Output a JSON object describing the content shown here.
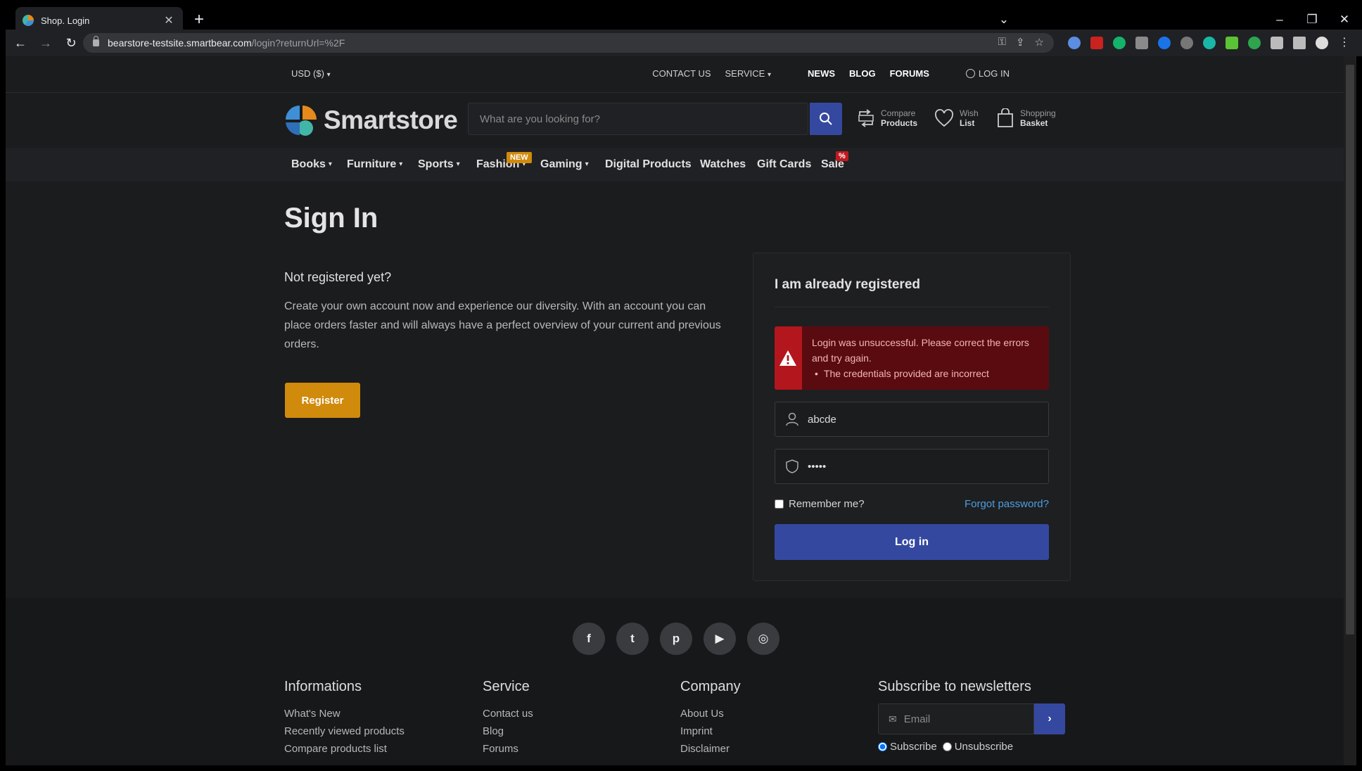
{
  "browser": {
    "tab_title": "Shop. Login",
    "new_tab": "+",
    "url_host": "bearstore-testsite.smartbear.com",
    "url_path": "/login?returnUrl=%2F"
  },
  "topbar": {
    "currency": "USD  ($)",
    "contact": "CONTACT US",
    "service": "SERVICE",
    "news": "NEWS",
    "blog": "BLOG",
    "forums": "FORUMS",
    "login": "LOG IN"
  },
  "header": {
    "logo_text": "Smartstore",
    "search_placeholder": "What are you looking for?",
    "compare_l1": "Compare",
    "compare_l2": "Products",
    "wish_l1": "Wish",
    "wish_l2": "List",
    "basket_l1": "Shopping",
    "basket_l2": "Basket"
  },
  "categories": {
    "books": "Books",
    "furniture": "Furniture",
    "sports": "Sports",
    "fashion": "Fashion",
    "fashion_badge": "NEW",
    "gaming": "Gaming",
    "digital": "Digital Products",
    "watches": "Watches",
    "giftcards": "Gift Cards",
    "sale": "Sale",
    "sale_badge": "%"
  },
  "main": {
    "title": "Sign In",
    "register_heading": "Not registered yet?",
    "register_text": "Create your own account now and experience our diversity. With an account you can place orders faster and will always have a perfect overview of your current and previous orders.",
    "register_button": "Register"
  },
  "login": {
    "title": "I am already registered",
    "error_message": "Login was unsuccessful. Please correct the errors and try again.",
    "error_detail": "The credentials provided are incorrect",
    "username": "abcde",
    "password": "•••••",
    "remember": "Remember me?",
    "forgot": "Forgot password?",
    "button": "Log in"
  },
  "footer": {
    "col1_title": "Informations",
    "col1_links": [
      "What's New",
      "Recently viewed products",
      "Compare products list"
    ],
    "col2_title": "Service",
    "col2_links": [
      "Contact us",
      "Blog",
      "Forums"
    ],
    "col3_title": "Company",
    "col3_links": [
      "About Us",
      "Imprint",
      "Disclaimer"
    ],
    "newsletter_title": "Subscribe to newsletters",
    "email_placeholder": "Email",
    "subscribe": "Subscribe",
    "unsubscribe": "Unsubscribe"
  },
  "colors": {
    "accent_blue": "#3548a0",
    "accent_orange": "#d08a0c",
    "error_red": "#b3161d"
  }
}
